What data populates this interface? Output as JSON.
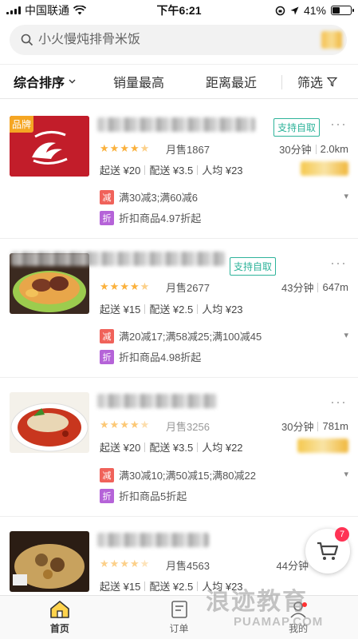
{
  "status_bar": {
    "carrier": "中国联通",
    "time": "下午6:21",
    "battery": "41%",
    "battery_level": 0.41
  },
  "search": {
    "placeholder": "小火慢炖排骨米饭"
  },
  "sort_bar": {
    "items": [
      "综合排序",
      "销量最高",
      "距离最近"
    ],
    "filter_label": "筛选"
  },
  "shops": [
    {
      "brand_tag": "品牌",
      "pickup": "支持自取",
      "rating": 4.5,
      "sales": "月售1867",
      "time": "30分钟",
      "distance": "2.0km",
      "min_order": "起送 ¥20",
      "delivery_fee": "配送 ¥3.5",
      "avg_price": "人均 ¥23",
      "promos": [
        {
          "badge": "减",
          "text": "满30减3;满60减6",
          "color": "#f0625a"
        },
        {
          "badge": "折",
          "text": "折扣商品4.97折起",
          "color": "#b563d8"
        }
      ]
    },
    {
      "pickup": "支持自取",
      "rating": 4.5,
      "sales": "月售2677",
      "time": "43分钟",
      "distance": "647m",
      "min_order": "起送 ¥15",
      "delivery_fee": "配送 ¥2.5",
      "avg_price": "人均 ¥23",
      "promos": [
        {
          "badge": "减",
          "text": "满20减17;满58减25;满100减45",
          "color": "#f0625a"
        },
        {
          "badge": "折",
          "text": "折扣商品4.98折起",
          "color": "#b563d8"
        }
      ]
    },
    {
      "rating": 4.5,
      "sales": "月售3256",
      "time": "30分钟",
      "distance": "781m",
      "min_order": "起送 ¥20",
      "delivery_fee": "配送 ¥3.5",
      "avg_price": "人均 ¥22",
      "promos": [
        {
          "badge": "减",
          "text": "满30减10;满50减15;满80减22",
          "color": "#f0625a"
        },
        {
          "badge": "折",
          "text": "折扣商品5折起",
          "color": "#b563d8"
        }
      ]
    },
    {
      "rating": 4.5,
      "sales": "月售4563",
      "time": "44分钟",
      "min_order": "起送 ¥15",
      "delivery_fee": "配送 ¥2.5",
      "avg_price": "人均 ¥23"
    }
  ],
  "cart": {
    "count": "7"
  },
  "tabs": [
    {
      "label": "首页",
      "icon": "home-icon"
    },
    {
      "label": "订单",
      "icon": "order-icon"
    },
    {
      "label": "我的",
      "icon": "profile-icon"
    }
  ],
  "watermark": {
    "main": "浪迹教育",
    "sub": "PUAMAP.COM"
  },
  "colors": {
    "accent": "#f5a623",
    "pickup_green": "#2eb39a",
    "star": "#fbb13c"
  }
}
